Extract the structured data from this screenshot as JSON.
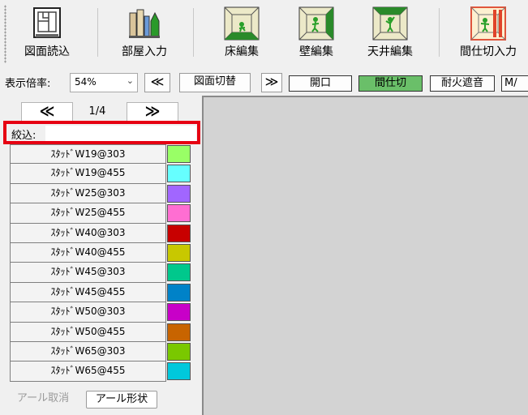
{
  "toolbar": {
    "buttons": [
      {
        "label": "図面読込",
        "icon": "drawing-read-icon"
      },
      {
        "label": "部屋入力",
        "icon": "room-input-icon"
      },
      {
        "label": "床編集",
        "icon": "floor-edit-icon"
      },
      {
        "label": "壁編集",
        "icon": "wall-edit-icon"
      },
      {
        "label": "天井編集",
        "icon": "ceiling-edit-icon"
      },
      {
        "label": "間仕切入力",
        "icon": "partition-input-icon"
      }
    ]
  },
  "zoom": {
    "label": "表示倍率:",
    "value": "54%"
  },
  "bar": {
    "prev_symbol": "≪",
    "switch_label": "図面切替",
    "next_symbol": "≫",
    "opening_label": "開口",
    "partition_label": "間仕切",
    "fire_label": "耐火遮音",
    "more_label": "M/"
  },
  "pager": {
    "prev_symbol": "≪",
    "page": "1/4",
    "next_symbol": "≫"
  },
  "filter": {
    "label": "絞込:",
    "value": ""
  },
  "list": [
    {
      "name": "ｽﾀｯﾄﾞW19@303",
      "color": "#99ff66"
    },
    {
      "name": "ｽﾀｯﾄﾞW19@455",
      "color": "#66ffff"
    },
    {
      "name": "ｽﾀｯﾄﾞW25@303",
      "color": "#a166ff"
    },
    {
      "name": "ｽﾀｯﾄﾞW25@455",
      "color": "#ff6ed2"
    },
    {
      "name": "ｽﾀｯﾄﾞW40@303",
      "color": "#c80000"
    },
    {
      "name": "ｽﾀｯﾄﾞW40@455",
      "color": "#c8c800"
    },
    {
      "name": "ｽﾀｯﾄﾞW45@303",
      "color": "#00c88c"
    },
    {
      "name": "ｽﾀｯﾄﾞW45@455",
      "color": "#0082c8"
    },
    {
      "name": "ｽﾀｯﾄﾞW50@303",
      "color": "#c800c8"
    },
    {
      "name": "ｽﾀｯﾄﾞW50@455",
      "color": "#c86400"
    },
    {
      "name": "ｽﾀｯﾄﾞW65@303",
      "color": "#7ac800"
    },
    {
      "name": "ｽﾀｯﾄﾞW65@455",
      "color": "#00c8dc"
    }
  ],
  "bottom": {
    "cancel_arc": "アール取消",
    "arc_shape": "アール形状"
  }
}
